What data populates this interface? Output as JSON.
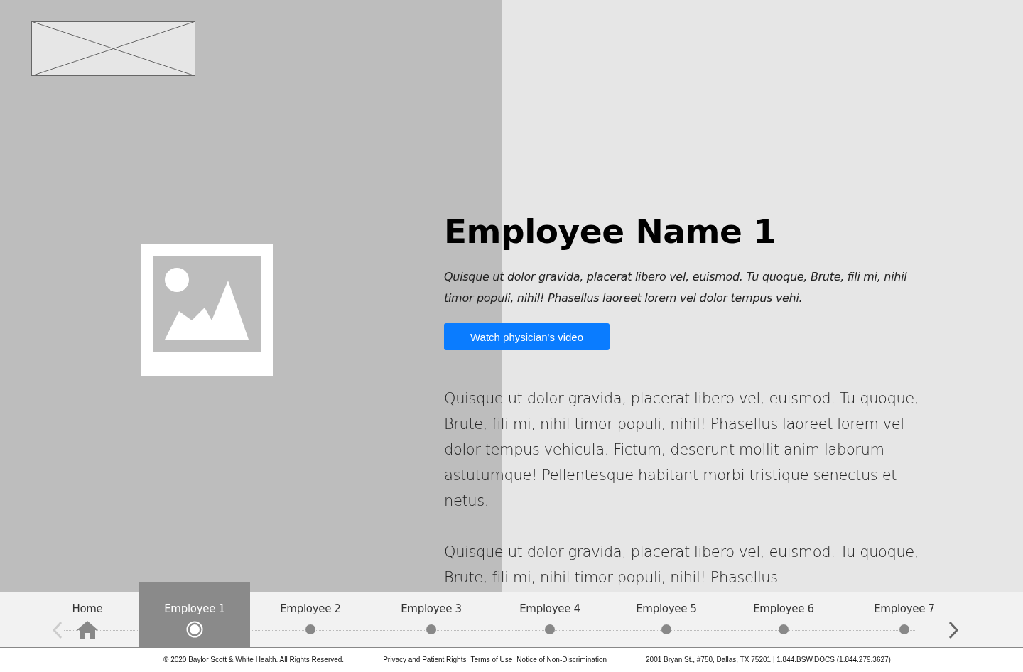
{
  "profile": {
    "name": "Employee Name 1",
    "summary": "Quisque ut dolor gravida, placerat libero vel, euismod. Tu quoque, Brute, fili mi, nihil timor populi, nihil! Phasellus laoreet lorem vel dolor tempus vehi.",
    "video_button": "Watch physician's video",
    "paragraphs": [
      "Quisque ut dolor gravida, placerat libero vel, euismod. Tu quoque, Brute, fili mi, nihil timor populi, nihil! Phasellus laoreet lorem vel dolor tempus vehicula. Fictum, deserunt mollit anim laborum astutumque! Pellentesque habitant morbi tristique senectus et netus.",
      "Quisque ut dolor gravida, placerat libero vel, euismod. Tu quoque, Brute, fili mi, nihil timor populi, nihil! Phasellus"
    ]
  },
  "nav": {
    "items": [
      {
        "label": "Home",
        "kind": "home",
        "selected": false
      },
      {
        "label": "Employee 1",
        "kind": "employee",
        "selected": true
      },
      {
        "label": "Employee 2",
        "kind": "employee",
        "selected": false
      },
      {
        "label": "Employee 3",
        "kind": "employee",
        "selected": false
      },
      {
        "label": "Employee 4",
        "kind": "employee",
        "selected": false
      },
      {
        "label": "Employee 5",
        "kind": "employee",
        "selected": false
      },
      {
        "label": "Employee 6",
        "kind": "employee",
        "selected": false
      },
      {
        "label": "Employee 7",
        "kind": "employee",
        "selected": false
      }
    ],
    "prev_disabled": true,
    "next_disabled": false
  },
  "footer": {
    "copyright": "© 2020 Baylor Scott & White Health. All Rights Reserved.",
    "links": [
      "Privacy and Patient Rights",
      "Terms of Use",
      "Notice of Non-Discrimination"
    ],
    "address": "2001 Bryan St., #750, Dallas, TX 75201 | 1.844.BSW.DOCS (1.844.279.3627)"
  }
}
